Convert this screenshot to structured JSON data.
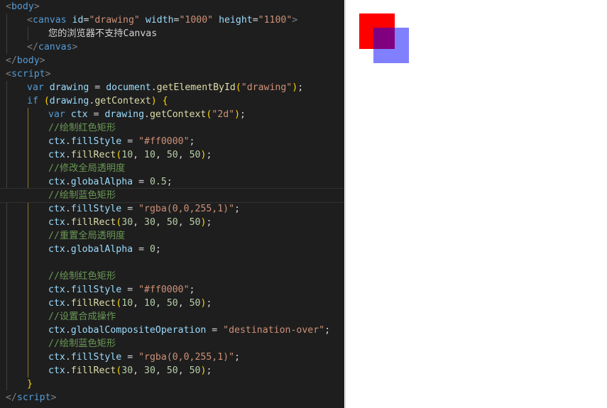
{
  "editor": {
    "lines": [
      {
        "indent": 0,
        "tokens": [
          {
            "t": "<",
            "c": "bracket"
          },
          {
            "t": "body",
            "c": "tag"
          },
          {
            "t": ">",
            "c": "bracket"
          }
        ]
      },
      {
        "indent": 1,
        "tokens": [
          {
            "t": "<",
            "c": "bracket"
          },
          {
            "t": "canvas",
            "c": "tag"
          },
          {
            "t": " ",
            "c": "txt"
          },
          {
            "t": "id",
            "c": "attr"
          },
          {
            "t": "=",
            "c": "txt"
          },
          {
            "t": "\"drawing\"",
            "c": "str"
          },
          {
            "t": " ",
            "c": "txt"
          },
          {
            "t": "width",
            "c": "attr"
          },
          {
            "t": "=",
            "c": "txt"
          },
          {
            "t": "\"1000\"",
            "c": "str"
          },
          {
            "t": " ",
            "c": "txt"
          },
          {
            "t": "height",
            "c": "attr"
          },
          {
            "t": "=",
            "c": "txt"
          },
          {
            "t": "\"1100\"",
            "c": "str"
          },
          {
            "t": ">",
            "c": "bracket"
          }
        ]
      },
      {
        "indent": 2,
        "tokens": [
          {
            "t": "您的浏览器不支持Canvas",
            "c": "txt"
          }
        ]
      },
      {
        "indent": 1,
        "tokens": [
          {
            "t": "</",
            "c": "bracket"
          },
          {
            "t": "canvas",
            "c": "tag"
          },
          {
            "t": ">",
            "c": "bracket"
          }
        ]
      },
      {
        "indent": 0,
        "tokens": [
          {
            "t": "</",
            "c": "bracket"
          },
          {
            "t": "body",
            "c": "tag"
          },
          {
            "t": ">",
            "c": "bracket"
          }
        ]
      },
      {
        "indent": 0,
        "tokens": [
          {
            "t": "<",
            "c": "bracket"
          },
          {
            "t": "script",
            "c": "tag"
          },
          {
            "t": ">",
            "c": "bracket"
          }
        ]
      },
      {
        "indent": 1,
        "tokens": [
          {
            "t": "var",
            "c": "kw"
          },
          {
            "t": " ",
            "c": "txt"
          },
          {
            "t": "drawing",
            "c": "var"
          },
          {
            "t": " = ",
            "c": "op"
          },
          {
            "t": "document",
            "c": "var"
          },
          {
            "t": ".",
            "c": "op"
          },
          {
            "t": "getElementById",
            "c": "fn"
          },
          {
            "t": "(",
            "c": "paren"
          },
          {
            "t": "\"drawing\"",
            "c": "str"
          },
          {
            "t": ")",
            "c": "paren"
          },
          {
            "t": ";",
            "c": "op"
          }
        ]
      },
      {
        "indent": 1,
        "tokens": [
          {
            "t": "if",
            "c": "kw"
          },
          {
            "t": " ",
            "c": "txt"
          },
          {
            "t": "(",
            "c": "paren"
          },
          {
            "t": "drawing",
            "c": "var"
          },
          {
            "t": ".",
            "c": "op"
          },
          {
            "t": "getContext",
            "c": "fn"
          },
          {
            "t": ")",
            "c": "paren"
          },
          {
            "t": " ",
            "c": "txt"
          },
          {
            "t": "{",
            "c": "paren"
          }
        ]
      },
      {
        "indent": 2,
        "tokens": [
          {
            "t": "var",
            "c": "kw"
          },
          {
            "t": " ",
            "c": "txt"
          },
          {
            "t": "ctx",
            "c": "var"
          },
          {
            "t": " = ",
            "c": "op"
          },
          {
            "t": "drawing",
            "c": "var"
          },
          {
            "t": ".",
            "c": "op"
          },
          {
            "t": "getContext",
            "c": "fn"
          },
          {
            "t": "(",
            "c": "paren"
          },
          {
            "t": "\"2d\"",
            "c": "str"
          },
          {
            "t": ")",
            "c": "paren"
          },
          {
            "t": ";",
            "c": "op"
          }
        ]
      },
      {
        "indent": 2,
        "tokens": [
          {
            "t": "//绘制红色矩形",
            "c": "cmt"
          }
        ]
      },
      {
        "indent": 2,
        "tokens": [
          {
            "t": "ctx",
            "c": "var"
          },
          {
            "t": ".",
            "c": "op"
          },
          {
            "t": "fillStyle",
            "c": "var"
          },
          {
            "t": " = ",
            "c": "op"
          },
          {
            "t": "\"#ff0000\"",
            "c": "str"
          },
          {
            "t": ";",
            "c": "op"
          }
        ]
      },
      {
        "indent": 2,
        "tokens": [
          {
            "t": "ctx",
            "c": "var"
          },
          {
            "t": ".",
            "c": "op"
          },
          {
            "t": "fillRect",
            "c": "fn"
          },
          {
            "t": "(",
            "c": "paren"
          },
          {
            "t": "10",
            "c": "num"
          },
          {
            "t": ", ",
            "c": "op"
          },
          {
            "t": "10",
            "c": "num"
          },
          {
            "t": ", ",
            "c": "op"
          },
          {
            "t": "50",
            "c": "num"
          },
          {
            "t": ", ",
            "c": "op"
          },
          {
            "t": "50",
            "c": "num"
          },
          {
            "t": ")",
            "c": "paren"
          },
          {
            "t": ";",
            "c": "op"
          }
        ]
      },
      {
        "indent": 2,
        "tokens": [
          {
            "t": "//修改全局透明度",
            "c": "cmt"
          }
        ]
      },
      {
        "indent": 2,
        "tokens": [
          {
            "t": "ctx",
            "c": "var"
          },
          {
            "t": ".",
            "c": "op"
          },
          {
            "t": "globalAlpha",
            "c": "var"
          },
          {
            "t": " = ",
            "c": "op"
          },
          {
            "t": "0.5",
            "c": "num"
          },
          {
            "t": ";",
            "c": "op"
          }
        ]
      },
      {
        "indent": 2,
        "active": true,
        "tokens": [
          {
            "t": "//绘制蓝色矩形",
            "c": "cmt"
          }
        ]
      },
      {
        "indent": 2,
        "tokens": [
          {
            "t": "ctx",
            "c": "var"
          },
          {
            "t": ".",
            "c": "op"
          },
          {
            "t": "fillStyle",
            "c": "var"
          },
          {
            "t": " = ",
            "c": "op"
          },
          {
            "t": "\"rgba(0,0,255,1)\"",
            "c": "str"
          },
          {
            "t": ";",
            "c": "op"
          }
        ]
      },
      {
        "indent": 2,
        "tokens": [
          {
            "t": "ctx",
            "c": "var"
          },
          {
            "t": ".",
            "c": "op"
          },
          {
            "t": "fillRect",
            "c": "fn"
          },
          {
            "t": "(",
            "c": "paren"
          },
          {
            "t": "30",
            "c": "num"
          },
          {
            "t": ", ",
            "c": "op"
          },
          {
            "t": "30",
            "c": "num"
          },
          {
            "t": ", ",
            "c": "op"
          },
          {
            "t": "50",
            "c": "num"
          },
          {
            "t": ", ",
            "c": "op"
          },
          {
            "t": "50",
            "c": "num"
          },
          {
            "t": ")",
            "c": "paren"
          },
          {
            "t": ";",
            "c": "op"
          }
        ]
      },
      {
        "indent": 2,
        "tokens": [
          {
            "t": "//重置全局透明度",
            "c": "cmt"
          }
        ]
      },
      {
        "indent": 2,
        "tokens": [
          {
            "t": "ctx",
            "c": "var"
          },
          {
            "t": ".",
            "c": "op"
          },
          {
            "t": "globalAlpha",
            "c": "var"
          },
          {
            "t": " = ",
            "c": "op"
          },
          {
            "t": "0",
            "c": "num"
          },
          {
            "t": ";",
            "c": "op"
          }
        ]
      },
      {
        "indent": 2,
        "tokens": []
      },
      {
        "indent": 2,
        "tokens": [
          {
            "t": "//绘制红色矩形",
            "c": "cmt"
          }
        ]
      },
      {
        "indent": 2,
        "tokens": [
          {
            "t": "ctx",
            "c": "var"
          },
          {
            "t": ".",
            "c": "op"
          },
          {
            "t": "fillStyle",
            "c": "var"
          },
          {
            "t": " = ",
            "c": "op"
          },
          {
            "t": "\"#ff0000\"",
            "c": "str"
          },
          {
            "t": ";",
            "c": "op"
          }
        ]
      },
      {
        "indent": 2,
        "tokens": [
          {
            "t": "ctx",
            "c": "var"
          },
          {
            "t": ".",
            "c": "op"
          },
          {
            "t": "fillRect",
            "c": "fn"
          },
          {
            "t": "(",
            "c": "paren"
          },
          {
            "t": "10",
            "c": "num"
          },
          {
            "t": ", ",
            "c": "op"
          },
          {
            "t": "10",
            "c": "num"
          },
          {
            "t": ", ",
            "c": "op"
          },
          {
            "t": "50",
            "c": "num"
          },
          {
            "t": ", ",
            "c": "op"
          },
          {
            "t": "50",
            "c": "num"
          },
          {
            "t": ")",
            "c": "paren"
          },
          {
            "t": ";",
            "c": "op"
          }
        ]
      },
      {
        "indent": 2,
        "tokens": [
          {
            "t": "//设置合成操作",
            "c": "cmt"
          }
        ]
      },
      {
        "indent": 2,
        "tokens": [
          {
            "t": "ctx",
            "c": "var"
          },
          {
            "t": ".",
            "c": "op"
          },
          {
            "t": "globalCompositeOperation",
            "c": "var"
          },
          {
            "t": " = ",
            "c": "op"
          },
          {
            "t": "\"destination-over\"",
            "c": "str"
          },
          {
            "t": ";",
            "c": "op"
          }
        ]
      },
      {
        "indent": 2,
        "tokens": [
          {
            "t": "//绘制蓝色矩形",
            "c": "cmt"
          }
        ]
      },
      {
        "indent": 2,
        "tokens": [
          {
            "t": "ctx",
            "c": "var"
          },
          {
            "t": ".",
            "c": "op"
          },
          {
            "t": "fillStyle",
            "c": "var"
          },
          {
            "t": " = ",
            "c": "op"
          },
          {
            "t": "\"rgba(0,0,255,1)\"",
            "c": "str"
          },
          {
            "t": ";",
            "c": "op"
          }
        ]
      },
      {
        "indent": 2,
        "tokens": [
          {
            "t": "ctx",
            "c": "var"
          },
          {
            "t": ".",
            "c": "op"
          },
          {
            "t": "fillRect",
            "c": "fn"
          },
          {
            "t": "(",
            "c": "paren"
          },
          {
            "t": "30",
            "c": "num"
          },
          {
            "t": ", ",
            "c": "op"
          },
          {
            "t": "30",
            "c": "num"
          },
          {
            "t": ", ",
            "c": "op"
          },
          {
            "t": "50",
            "c": "num"
          },
          {
            "t": ", ",
            "c": "op"
          },
          {
            "t": "50",
            "c": "num"
          },
          {
            "t": ")",
            "c": "paren"
          },
          {
            "t": ";",
            "c": "op"
          }
        ]
      },
      {
        "indent": 1,
        "tokens": [
          {
            "t": "}",
            "c": "paren"
          }
        ]
      },
      {
        "indent": 0,
        "tokens": [
          {
            "t": "</",
            "c": "bracket"
          },
          {
            "t": "script",
            "c": "tag"
          },
          {
            "t": ">",
            "c": "bracket"
          }
        ]
      }
    ]
  },
  "preview": {
    "rects": [
      {
        "name": "red-rectangle",
        "color": "#ff0000"
      },
      {
        "name": "blue-rectangle-overlap",
        "color": "#8080ff"
      },
      {
        "name": "overlap-region",
        "color": "#80007f"
      }
    ]
  }
}
